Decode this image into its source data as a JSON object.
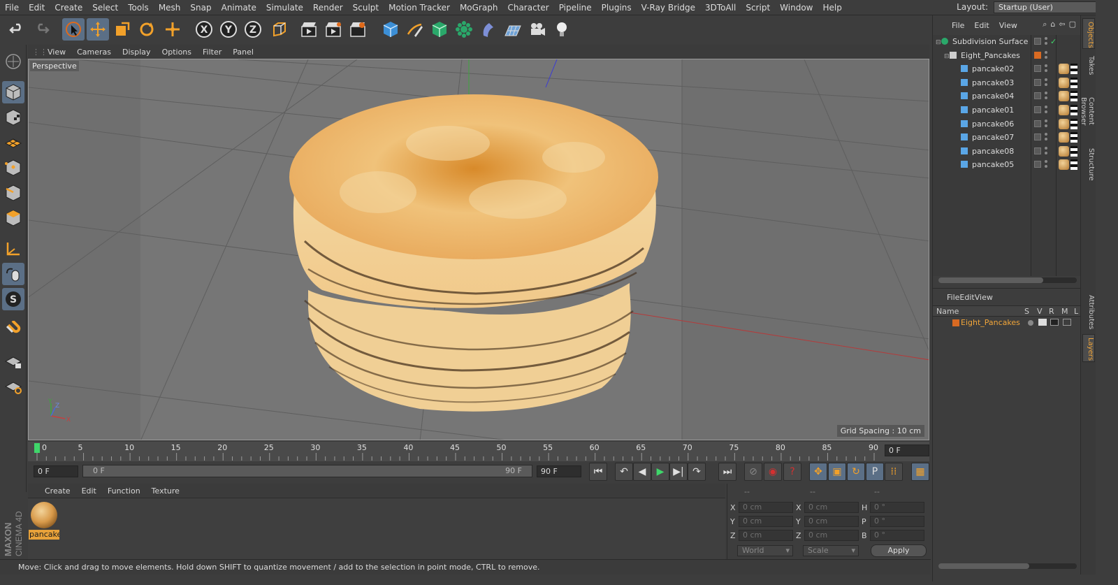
{
  "menu": [
    "File",
    "Edit",
    "Create",
    "Select",
    "Tools",
    "Mesh",
    "Snap",
    "Animate",
    "Simulate",
    "Render",
    "Sculpt",
    "Motion Tracker",
    "MoGraph",
    "Character",
    "Pipeline",
    "Plugins",
    "V-Ray Bridge",
    "3DToAll",
    "Script",
    "Window",
    "Help"
  ],
  "layout": {
    "label": "Layout:",
    "value": "Startup (User)"
  },
  "viewport": {
    "menu": [
      "View",
      "Cameras",
      "Display",
      "Options",
      "Filter",
      "Panel"
    ],
    "camera_label": "Perspective",
    "grid_spacing": "Grid Spacing : 10 cm"
  },
  "timeline": {
    "ticks": [
      "0",
      "5",
      "10",
      "15",
      "20",
      "25",
      "30",
      "35",
      "40",
      "45",
      "50",
      "55",
      "60",
      "65",
      "70",
      "75",
      "80",
      "85",
      "90"
    ],
    "current_frame": "0 F",
    "start_field": "0 F",
    "slider_start": "0 F",
    "slider_end": "90 F",
    "end_field": "90 F"
  },
  "material_manager": {
    "menu": [
      "Create",
      "Edit",
      "Function",
      "Texture"
    ],
    "material_name": "pancake"
  },
  "coordinates": {
    "header": [
      "--",
      "--",
      "--"
    ],
    "rows": [
      {
        "a": "X",
        "av": "0 cm",
        "b": "X",
        "bv": "0 cm",
        "c": "H",
        "cv": "0 °"
      },
      {
        "a": "Y",
        "av": "0 cm",
        "b": "Y",
        "bv": "0 cm",
        "c": "P",
        "cv": "0 °"
      },
      {
        "a": "Z",
        "av": "0 cm",
        "b": "Z",
        "bv": "0 cm",
        "c": "B",
        "cv": "0 °"
      }
    ],
    "space": "World",
    "mode": "Scale",
    "apply": "Apply"
  },
  "status": "Move: Click and drag to move elements. Hold down SHIFT to quantize movement / add to the selection in point mode, CTRL to remove.",
  "object_manager": {
    "menu": [
      "File",
      "Edit",
      "View"
    ],
    "objects": [
      {
        "name": "Subdivision Surface",
        "type": "subdiv"
      },
      {
        "name": "Eight_Pancakes",
        "type": "null"
      },
      {
        "name": "pancake02",
        "type": "mesh"
      },
      {
        "name": "pancake03",
        "type": "mesh"
      },
      {
        "name": "pancake04",
        "type": "mesh"
      },
      {
        "name": "pancake01",
        "type": "mesh"
      },
      {
        "name": "pancake06",
        "type": "mesh"
      },
      {
        "name": "pancake07",
        "type": "mesh"
      },
      {
        "name": "pancake08",
        "type": "mesh"
      },
      {
        "name": "pancake05",
        "type": "mesh"
      }
    ]
  },
  "layer_manager": {
    "menu": [
      "File",
      "Edit",
      "View"
    ],
    "columns": [
      "Name",
      "S",
      "V",
      "R",
      "M",
      "L"
    ],
    "layers": [
      "Eight_Pancakes"
    ]
  },
  "side_tabs": [
    "Objects",
    "Takes",
    "Content Browser",
    "Structure",
    "Attributes",
    "Layers"
  ],
  "brand": {
    "line1": "MAXON",
    "line2": "CINEMA 4D"
  },
  "colors": {
    "accent": "#e8a23a",
    "selection_blue": "#5b6f86",
    "viewport_bg": "#6f6f6f"
  }
}
